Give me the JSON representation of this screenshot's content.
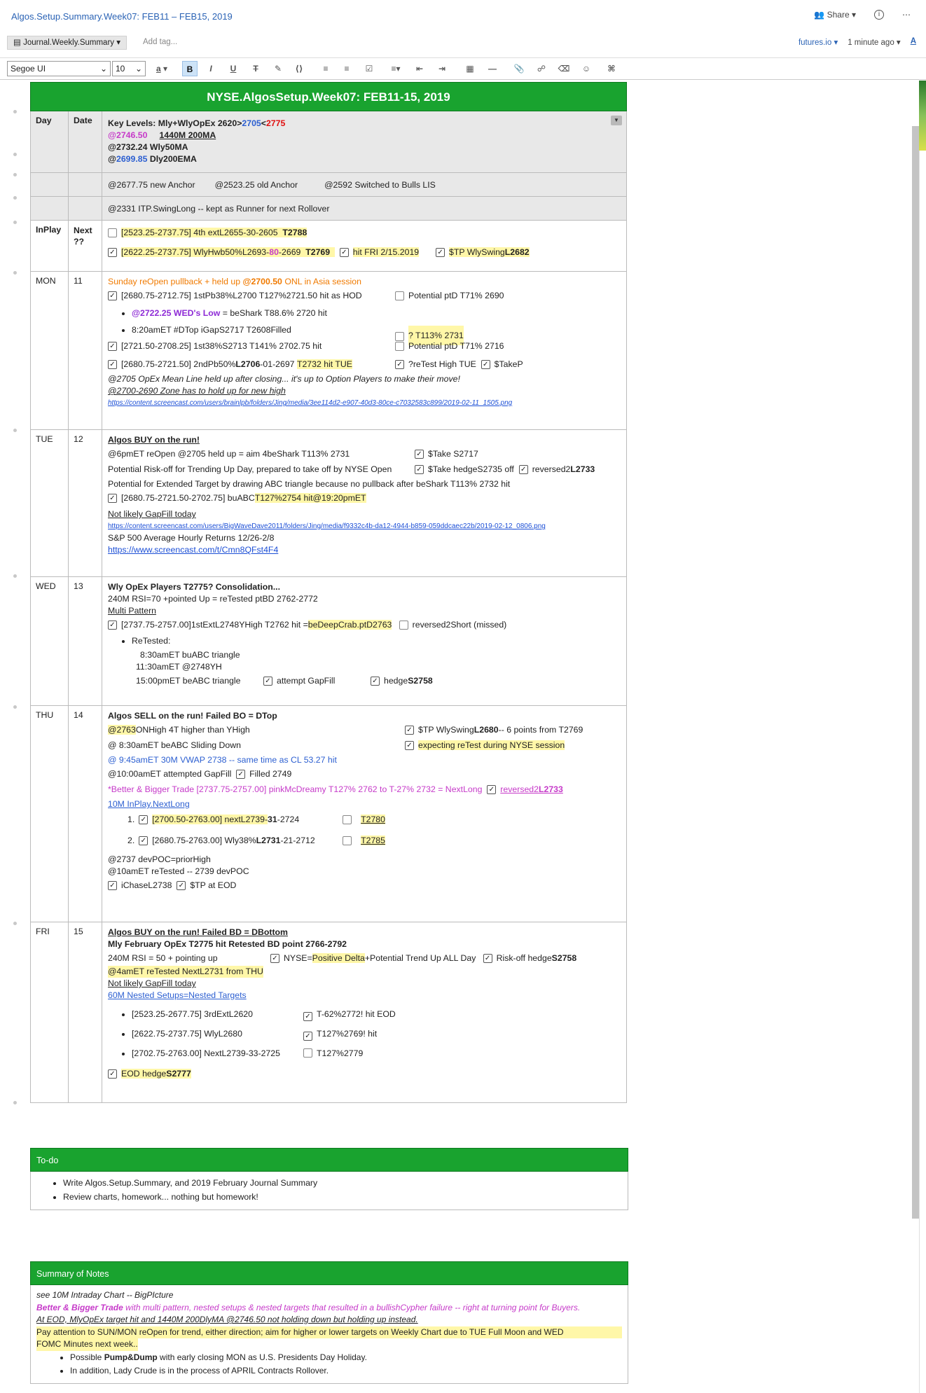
{
  "window": {
    "title": "Algos.Setup.Summary.Week07: FEB11 – FEB15, 2019",
    "share": "Share"
  },
  "notebar": {
    "notebook": "Journal.Weekly.Summary",
    "add_tag": "Add tag...",
    "workspace": "futures.io",
    "saved": "1 minute ago"
  },
  "toolbar": {
    "font": "Segoe UI",
    "size": "10"
  },
  "table": {
    "title": "NYSE.AlgosSetup.Week07: FEB11-15, 2019",
    "head": {
      "day": "Day",
      "date": "Date",
      "k1a": "Key Levels:  Mly+WlyOpEx 2620>",
      "k1b": "2705",
      "k1c": "<",
      "k1d": "2775",
      "k2a": "@2746.50",
      "k2b": "1440M 200MA",
      "k3": "@2732.24 Wly50MA",
      "k4a": "@",
      "k4b": "2699.85",
      "k4c": " Dly200EMA"
    },
    "anchor": {
      "a": "@2677.75 new Anchor",
      "b": "@2523.25 old Anchor",
      "c": "@2592 Switched to Bulls LIS"
    },
    "itp": "@2331 ITP.SwingLong -- kept as Runner for next Rollover",
    "inplay": {
      "day": "InPlay",
      "date": "Next ??",
      "l1a": "[2523.25-2737.75] 4th extL2655-30-2605",
      "l1b": "T2788",
      "l2a": "[2622.25-2737.75] WlyHwb50%L2693-",
      "l2b": "80",
      "l2c": "-2669",
      "l2d": "T2769",
      "l2e": "hit FRI 2/15.2019",
      "l2f": "$TP WlySwing",
      "l2g": "L2682"
    },
    "mon": {
      "day": "MON",
      "date": "11",
      "l1a": "Sunday reOpen pullback + held up ",
      "l1b": "@2700.50",
      "l1c": " ONL in Asia session",
      "l2": "[2680.75-2712.75] 1stPb38%L2700 T127%2721.50 hit as HOD",
      "l2r": "Potential ptD T71% 2690",
      "l3a": "@2722.25 WED's Low",
      "l3b": " = beShark T88.6% 2720 hit",
      "l3r": "? T113% 2731",
      "l4": "8:20amET #DTop iGapS2717 T2608Filled",
      "l5": "[2721.50-2708.25] 1st38%S2713 T141% 2702.75 hit",
      "l5r": "Potential ptD T71% 2716",
      "l6a": "[2680.75-2721.50] 2ndPb50%",
      "l6b": "L2706",
      "l6c": "-01-2697",
      "l6d": "T2732 hit TUE",
      "l6r1": "?reTest High TUE",
      "l6r2": "$TakeP",
      "l7": "@2705 OpEx Mean Line held up after closing... it's up to Option Players to make their move!",
      "l8": "@2700-2690 Zone has to hold up for new high",
      "l9": "https://content.screencast.com/users/brainlpb/folders/Jing/media/3ee114d2-e907-40d3-80ce-c7032583c899/2019-02-11_1505.png"
    },
    "tue": {
      "day": "TUE",
      "date": "12",
      "l1": "Algos BUY on the run!",
      "l2": "@6pmET reOpen  @2705 held up = aim 4beShark T113% 2731",
      "l2r": "$Take S2717",
      "l3": "Potential Risk-off for Trending Up Day, prepared to take off by NYSE Open",
      "l3r1": "$Take hedgeS2735 off",
      "l3r2a": "reversed2",
      "l3r2b": "L2733",
      "l4": "Potential for Extended Target by drawing ABC triangle because no pullback after beShark T113% 2732 hit",
      "l5a": "[2680.75-2721.50-2702.75] buABC ",
      "l5b": "T127%2754 hit@19:20pmET",
      "l6": "Not likely GapFill today",
      "l7": "https://content.screencast.com/users/BigWaveDave2011/folders/Jing/media/f9332c4b-da12-4944-b859-059ddcaec22b/2019-02-12_0806.png",
      "l8": "S&P 500 Average Hourly Returns 12/26-2/8",
      "l9": "https://www.screencast.com/t/Cmn8QFst4F4"
    },
    "wed": {
      "day": "WED",
      "date": "13",
      "l1": "Wly OpEx Players T2775?  Consolidation...",
      "l2": "240M RSI=70 +pointed Up = reTested ptBD 2762-2772",
      "l3": "Multi Pattern",
      "l4a": "[2737.75-2757.00]1stExtL2748YHigh T2762 hit =",
      "l4b": "beDeepCrab.ptD2763",
      "l4r": "reversed2Short (missed)",
      "l5": "ReTested:",
      "l6": "8:30amET buABC triangle",
      "l7": "11:30amET @2748YH",
      "l8": "15:00pmET beABC triangle",
      "l8r1": "attempt GapFill",
      "l8r2a": "hedge",
      "l8r2b": "S2758"
    },
    "thu": {
      "day": "THU",
      "date": "14",
      "l1": "Algos SELL on the run!  Failed BO = DTop",
      "l2a": "@2763",
      "l2b": " ONHigh 4T higher than YHigh",
      "l2r1": "$TP WlySwing",
      "l2r2": "L2680",
      "l2r3": "  -- 6 points from T2769",
      "l3": "@ 8:30amET beABC Sliding Down",
      "l3r": "expecting reTest during NYSE session",
      "l4": "@ 9:45amET 30M VWAP 2738  -- same time as CL 53.27 hit",
      "l5": "@10:00amET attempted GapFill",
      "l5r": "Filled 2749",
      "l6": "*Better & Bigger Trade [2737.75-2757.00] pinkMcDreamy T127% 2762 to T-27% 2732 = NextLong",
      "l6r1": "reversed2",
      "l6r2": "L2733",
      "l7": "10M InPlay.NextLong",
      "l8a": "[2700.50-2763.00] nextL2739-",
      "l8b": "31",
      "l8c": "-2724",
      "l8r": "T2780",
      "l9a": "[2680.75-2763.00] Wly38%",
      "l9b": "L2731",
      "l9c": "-21-2712",
      "l9r": "T2785",
      "l10": "@2737 devPOC=priorHigh",
      "l11": "@10amET reTested -- 2739 devPOC",
      "l12a": "iChaseL2738",
      "l12b": "$TP at EOD"
    },
    "fri": {
      "day": "FRI",
      "date": "15",
      "l1": "Algos BUY on the run!   Failed BD = DBottom",
      "l2": "Mly February OpEx T2775 hit  Retested BD point 2766-2792",
      "l3": "240M RSI = 50 + pointing up",
      "l3r1a": "NYSE=",
      "l3r1b": "Positive Delta",
      "l3r1c": " +Potential Trend Up ALL Day",
      "l3r2a": "Risk-off hedge",
      "l3r2b": "S2758",
      "l4": "@4amET reTested NextL2731 from THU",
      "l5": "Not likely GapFill today",
      "l6": "60M Nested Setups=Nested Targets",
      "l7": "[2523.25-2677.75] 3rdExtL2620",
      "l7r": "T-62%2772! hit EOD",
      "l8": "[2622.75-2737.75] WlyL2680",
      "l8r": "T127%2769! hit",
      "l9": "[2702.75-2763.00] NextL2739-33-2725",
      "l9r": "T127%2779",
      "l10a": "EOD hedge",
      "l10b": "S2777"
    }
  },
  "todo": {
    "title": "To-do",
    "items": [
      "Write Algos.Setup.Summary, and 2019 February Journal Summary",
      "Review charts, homework... nothing but homework!"
    ]
  },
  "summary": {
    "title": "Summary of Notes",
    "l1": "see 10M Intraday Chart --  BigPIcture",
    "l2a": "Better & Bigger Trade",
    "l2b": " with multi pattern, nested setups & nested targets that resulted in a bullishCypher failure -- right at turning point for Buyers.",
    "l3": "At EOD, MlyOpEx target hit and 1440M 200DlyMA @2746.50 not holding down but holding up instead.",
    "l4": "Pay attention to SUN/MON reOpen for trend, either direction; aim for higher or lower targets on Weekly Chart due to TUE Full Moon and WED",
    "l5": "FOMC Minutes next week..",
    "l6a": "Possible ",
    "l6b": "Pump&Dump",
    "l6c": " with early closing MON as U.S. Presidents Day Holiday.",
    "l7": "In addition, Lady Crude is in the process of APRIL Contracts Rollover."
  }
}
